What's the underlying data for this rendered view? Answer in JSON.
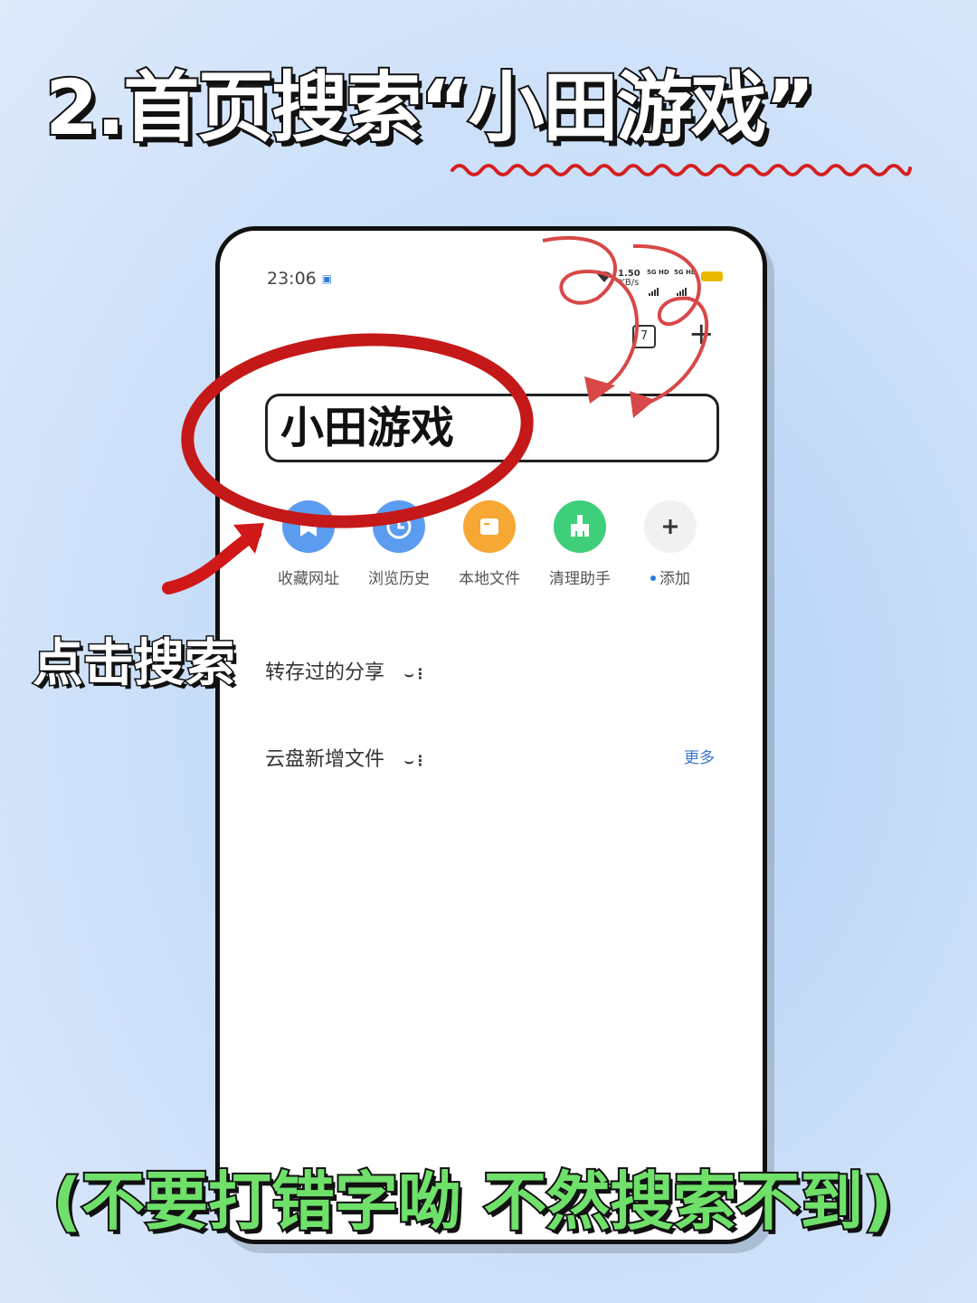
{
  "headline": "2.首页搜索“小田游戏”",
  "status_bar": {
    "time": "23:06",
    "net_speed_value": "1.50",
    "net_speed_unit": "KB/s",
    "sim1": "5G HD",
    "sim2": "5G HD"
  },
  "toolbar": {
    "tab_count": "7",
    "add_tab": "+"
  },
  "search": {
    "query": "小田游戏"
  },
  "shortcuts": [
    {
      "label": "收藏网址",
      "icon": "bookmark-icon",
      "color": "#5b9cf0"
    },
    {
      "label": "浏览历史",
      "icon": "history-icon",
      "color": "#5b9cf0"
    },
    {
      "label": "本地文件",
      "icon": "folder-icon",
      "color": "#f7a734"
    },
    {
      "label": "清理助手",
      "icon": "broom-icon",
      "color": "#3fcf7a"
    },
    {
      "label": "添加",
      "icon": "plus-icon",
      "color": "#f1f1f1"
    }
  ],
  "sections": {
    "shared": "转存过的分享",
    "cloud": "云盘新增文件",
    "more": "更多"
  },
  "annotations": {
    "click_search": "点击搜索",
    "note": "(不要打错字呦 不然搜索不到)",
    "accent_red": "#d01818",
    "accent_green": "#6fe06a"
  }
}
